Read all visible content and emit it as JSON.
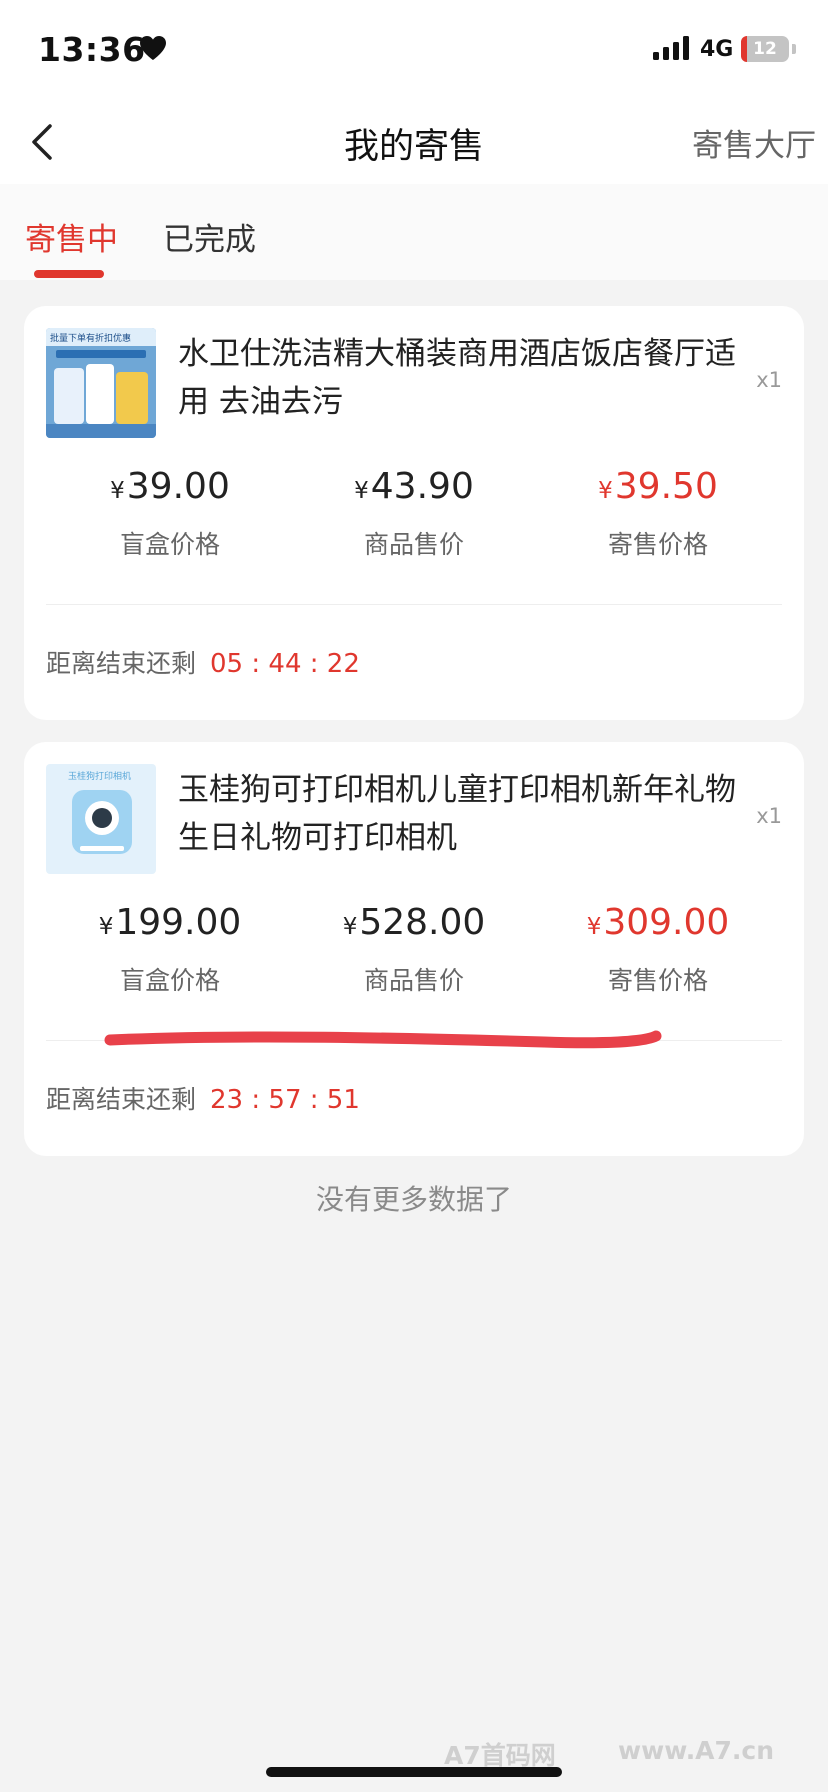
{
  "status_bar": {
    "time": "13:36",
    "network": "4G",
    "battery": "12",
    "battery_level": 0.12,
    "heart_icon": "heart-icon",
    "signal_icon": "signal-icon"
  },
  "nav": {
    "back_icon": "chevron-left-icon",
    "title": "我的寄售",
    "right_link": "寄售大厅"
  },
  "tabs": [
    {
      "label": "寄售中",
      "active": true
    },
    {
      "label": "已完成",
      "active": false
    }
  ],
  "items": [
    {
      "title": "水卫仕洗洁精大桶装商用酒店饭店餐厅适用 去油去污",
      "quantity": "x1",
      "thumb_banner": "批量下单有折扣优惠",
      "blind_box_price": "39.00",
      "blind_box_label": "盲盒价格",
      "sale_price": "43.90",
      "sale_label": "商品售价",
      "consign_price": "39.50",
      "consign_label": "寄售价格",
      "countdown_label": "距离结束还剩",
      "countdown_h": "05",
      "countdown_m": "44",
      "countdown_s": "22"
    },
    {
      "title": "玉桂狗可打印相机儿童打印相机新年礼物生日礼物可打印相机",
      "quantity": "x1",
      "thumb_banner": "玉桂狗打印相机",
      "blind_box_price": "199.00",
      "blind_box_label": "盲盒价格",
      "sale_price": "528.00",
      "sale_label": "商品售价",
      "consign_price": "309.00",
      "consign_label": "寄售价格",
      "countdown_label": "距离结束还剩",
      "countdown_h": "23",
      "countdown_m": "57",
      "countdown_s": "51"
    }
  ],
  "currency": "¥",
  "time_separator": ":",
  "no_more": "没有更多数据了",
  "watermark": {
    "site": "A7首码网",
    "url": "www.A7.cn"
  },
  "colors": {
    "accent": "#e0372e",
    "background": "#f3f3f3",
    "card": "#ffffff"
  }
}
